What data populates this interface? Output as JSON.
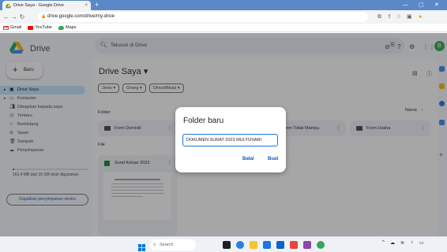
{
  "browser": {
    "tab_title": "Drive Saya - Google Drive",
    "tab_close": "×",
    "new_tab": "+",
    "url": "drive.google.com/drive/my-drive",
    "bookmarks": [
      "Gmail",
      "YouTube",
      "Maps"
    ]
  },
  "header": {
    "app_name": "Drive",
    "search_placeholder": "Telusuri di Drive"
  },
  "sidebar": {
    "new_label": "Baru",
    "items": [
      {
        "label": "Drive Saya",
        "icon": "drive-icon"
      },
      {
        "label": "Komputer",
        "icon": "computer-icon"
      },
      {
        "label": "Dibagikan kepada saya",
        "icon": "shared-icon"
      },
      {
        "label": "Terbaru",
        "icon": "clock-icon"
      },
      {
        "label": "Berbintang",
        "icon": "star-icon"
      },
      {
        "label": "Spam",
        "icon": "spam-icon"
      },
      {
        "label": "Sampah",
        "icon": "trash-icon"
      },
      {
        "label": "Penyimpanan",
        "icon": "cloud-icon"
      }
    ],
    "storage_text": "161,4 MB dari 15 GB telah digunakan",
    "storage_fraction": 0.011,
    "buy_storage": "Dapatkan penyimpanan ekstra"
  },
  "main": {
    "title": "Drive Saya",
    "title_caret": "▾",
    "chips": [
      "Jenis ▾",
      "Orang ▾",
      "Dimodifikasi ▾"
    ],
    "folder_section": "Folder",
    "sort_label": "Nama",
    "sort_arrow": "↑",
    "folders": [
      "Form Domisili",
      "Form Tidak Mampu",
      "Form Usaha"
    ],
    "file_section": "File",
    "files": [
      {
        "name": "Surat Keluar 2023"
      }
    ]
  },
  "dialog": {
    "title": "Folder baru",
    "input_value": "DOKUMEN SURAT 2023 MULYOSARI",
    "cancel": "Batal",
    "create": "Buat"
  },
  "taskbar": {
    "search": "Search"
  },
  "colors": {
    "accent": "#0b57d0",
    "active_nav": "#c2e7ff",
    "tabbar": "#5b89c8"
  }
}
